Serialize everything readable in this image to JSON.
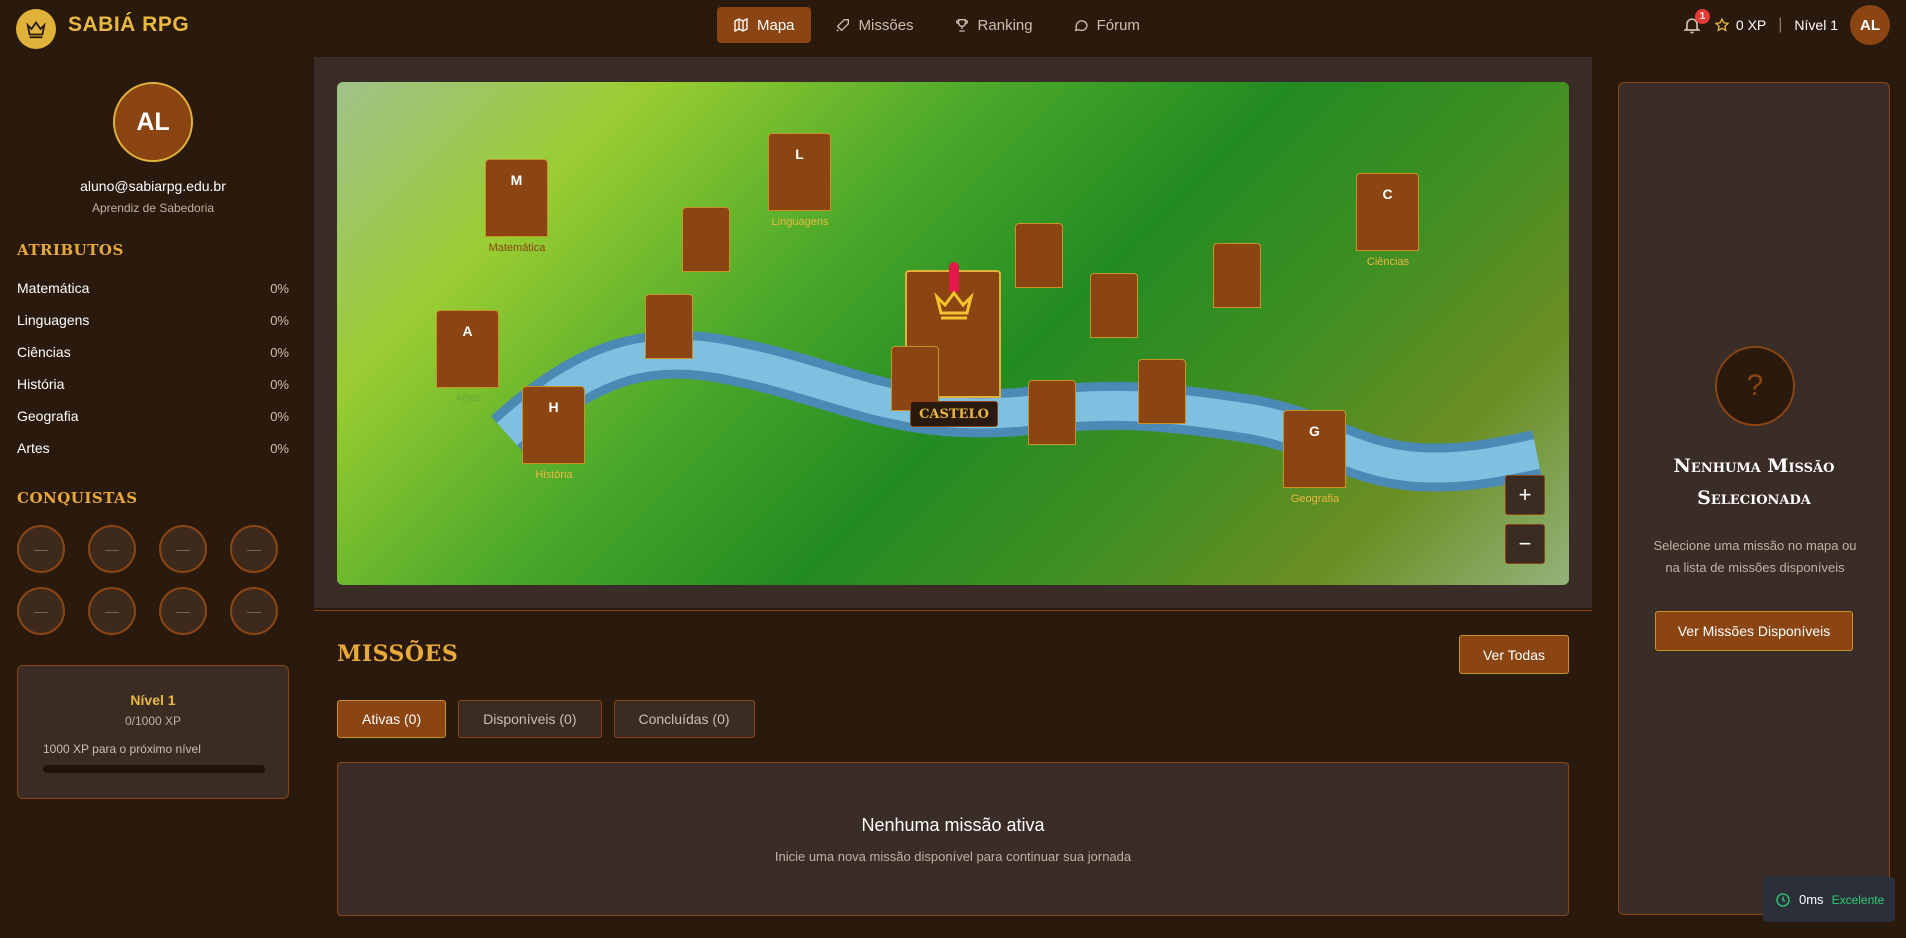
{
  "header": {
    "app_title": "SABIÁ RPG",
    "nav": [
      {
        "label": "Mapa",
        "icon": "map-icon",
        "active": true
      },
      {
        "label": "Missões",
        "icon": "sword-icon",
        "active": false
      },
      {
        "label": "Ranking",
        "icon": "trophy-icon",
        "active": false
      },
      {
        "label": "Fórum",
        "icon": "chat-icon",
        "active": false
      }
    ],
    "notification_count": "1",
    "xp": "0 XP",
    "separator": "|",
    "level": "Nível 1",
    "avatar_initials": "AL"
  },
  "sidebar": {
    "avatar_initials": "AL",
    "email": "aluno@sabiarpg.edu.br",
    "role": "Aprendiz de Sabedoria",
    "attributes_title": "ATRIBUTOS",
    "attributes": [
      {
        "name": "Matemática",
        "value": "0%"
      },
      {
        "name": "Linguagens",
        "value": "0%"
      },
      {
        "name": "Ciências",
        "value": "0%"
      },
      {
        "name": "História",
        "value": "0%"
      },
      {
        "name": "Geografia",
        "value": "0%"
      },
      {
        "name": "Artes",
        "value": "0%"
      }
    ],
    "achievements_title": "CONQUISTAS",
    "achievement_placeholder": "—",
    "level_card": {
      "title": "Nível 1",
      "xp": "0/1000 XP",
      "next": "1000 XP para o próximo nível",
      "progress": 0
    }
  },
  "map": {
    "buildings": [
      {
        "letter": "M",
        "label": "Matemática"
      },
      {
        "letter": "L",
        "label": "Linguagens"
      },
      {
        "letter": "C",
        "label": "Ciências"
      },
      {
        "letter": "A",
        "label": "Artes"
      },
      {
        "letter": "H",
        "label": "História"
      },
      {
        "letter": "G",
        "label": "Geografia"
      }
    ],
    "castle_label": "CASTELO",
    "zoom_in": "+",
    "zoom_out": "−"
  },
  "missions": {
    "title": "MISSÕES",
    "see_all": "Ver Todas",
    "tabs": [
      {
        "label": "Ativas (0)",
        "active": true
      },
      {
        "label": "Disponíveis (0)",
        "active": false
      },
      {
        "label": "Concluídas (0)",
        "active": false
      }
    ],
    "empty_title": "Nenhuma missão ativa",
    "empty_sub": "Inicie uma nova missão disponível para continuar sua jornada"
  },
  "right_panel": {
    "icon_glyph": "?",
    "title": "Nenhuma Missão Selecionada",
    "desc": "Selecione uma missão no mapa ou na lista de missões disponíveis",
    "button": "Ver Missões Disponíveis"
  },
  "perf": {
    "time": "0ms",
    "status": "Excelente"
  },
  "colors": {
    "accent": "#8b4513",
    "gold": "#e8b840",
    "background": "#2a1a0d"
  }
}
